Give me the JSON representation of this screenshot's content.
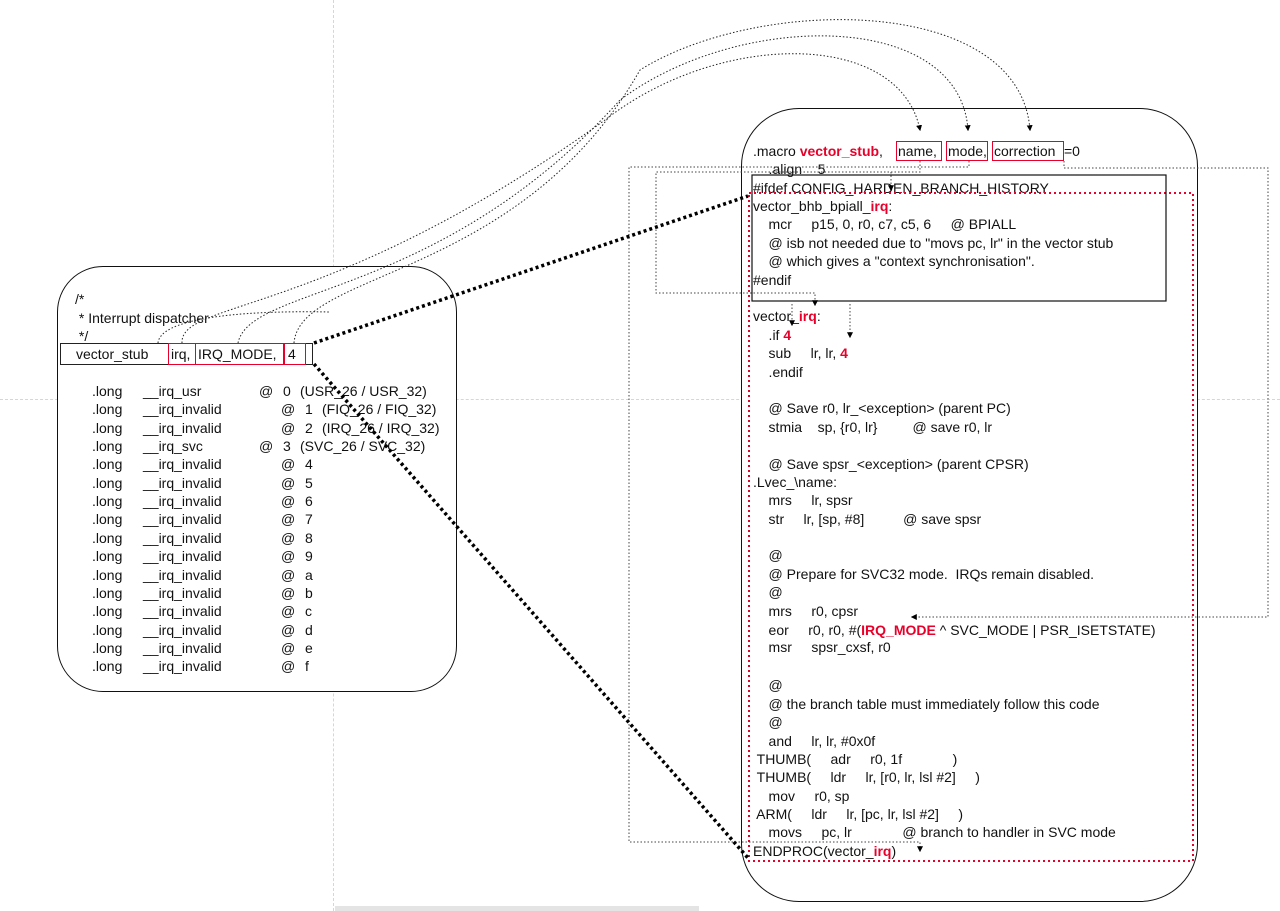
{
  "left_code": {
    "comment_open": "/*",
    "comment_text": " * Interrupt dispatcher",
    "comment_close": " */",
    "invocation": {
      "macro": "vector_stub",
      "arg_name": "irq,",
      "arg_mode": "IRQ_MODE,",
      "arg_correction": "4"
    },
    "table": [
      {
        "dir": ".long",
        "sym": "__irq_usr",
        "at": "@",
        "idx": "0",
        "comment": "(USR_26 / USR_32)"
      },
      {
        "dir": ".long",
        "sym": "__irq_invalid",
        "at": "@",
        "idx": "1",
        "comment": "(FIQ_26 / FIQ_32)"
      },
      {
        "dir": ".long",
        "sym": "__irq_invalid",
        "at": "@",
        "idx": "2",
        "comment": "(IRQ_26 / IRQ_32)"
      },
      {
        "dir": ".long",
        "sym": "__irq_svc",
        "at": "@",
        "idx": "3",
        "comment": "(SVC_26 / SVC_32)"
      },
      {
        "dir": ".long",
        "sym": "__irq_invalid",
        "at": "@",
        "idx": "4",
        "comment": ""
      },
      {
        "dir": ".long",
        "sym": "__irq_invalid",
        "at": "@",
        "idx": "5",
        "comment": ""
      },
      {
        "dir": ".long",
        "sym": "__irq_invalid",
        "at": "@",
        "idx": "6",
        "comment": ""
      },
      {
        "dir": ".long",
        "sym": "__irq_invalid",
        "at": "@",
        "idx": "7",
        "comment": ""
      },
      {
        "dir": ".long",
        "sym": "__irq_invalid",
        "at": "@",
        "idx": "8",
        "comment": ""
      },
      {
        "dir": ".long",
        "sym": "__irq_invalid",
        "at": "@",
        "idx": "9",
        "comment": ""
      },
      {
        "dir": ".long",
        "sym": "__irq_invalid",
        "at": "@",
        "idx": "a",
        "comment": ""
      },
      {
        "dir": ".long",
        "sym": "__irq_invalid",
        "at": "@",
        "idx": "b",
        "comment": ""
      },
      {
        "dir": ".long",
        "sym": "__irq_invalid",
        "at": "@",
        "idx": "c",
        "comment": ""
      },
      {
        "dir": ".long",
        "sym": "__irq_invalid",
        "at": "@",
        "idx": "d",
        "comment": ""
      },
      {
        "dir": ".long",
        "sym": "__irq_invalid",
        "at": "@",
        "idx": "e",
        "comment": ""
      },
      {
        "dir": ".long",
        "sym": "__irq_invalid",
        "at": "@",
        "idx": "f",
        "comment": ""
      }
    ]
  },
  "right_code": {
    "macro_kw": ".macro ",
    "macro_name": "vector_stub",
    "comma": ",",
    "param_name": "name,",
    "param_mode": "mode,",
    "param_correction": "correction",
    "param_default": "=0",
    "align": "    .align    5",
    "ifdef": "#ifdef CONFIG_HARDEN_BRANCH_HISTORY",
    "bhb_label_prefix": "vector_bhb_bpiall_",
    "bhb_label_irq": "irq",
    "bhb_label_suffix": ":",
    "mcr": "    mcr     p15, 0, r0, c7, c5, 6     @ BPIALL",
    "isb1": "    @ isb not needed due to \"movs pc, lr\" in the vector stub",
    "isb2": "    @ which gives a \"context synchronisation\".",
    "endif1": "#endif",
    "vec_prefix": "vector_",
    "vec_irq": "irq",
    "vec_suffix": ":",
    "if_kw": "    .if ",
    "if_val": "4",
    "sub_kw": "    sub     lr, lr, ",
    "sub_val": "4",
    "endif2": "    .endif",
    "save_r0": "    @ Save r0, lr_<exception> (parent PC)",
    "stmia": "    stmia    sp, {r0, lr}         @ save r0, lr",
    "save_spsr": "    @ Save spsr_<exception> (parent CPSR)",
    "lvec": ".Lvec_\\name:",
    "mrs1": "    mrs     lr, spsr",
    "str": "    str     lr, [sp, #8]          @ save spsr",
    "at1": "    @",
    "prepare": "    @ Prepare for SVC32 mode.  IRQs remain disabled.",
    "at2": "    @",
    "mrs2": "    mrs     r0, cpsr",
    "eor_prefix": "    eor     r0, r0, #(",
    "eor_mode": "IRQ_MODE",
    "eor_suffix": " ^ SVC_MODE | PSR_ISETSTATE)",
    "msr": "    msr     spsr_cxsf, r0",
    "at3": "    @",
    "branch_table": "    @ the branch table must immediately follow this code",
    "at4": "    @",
    "and": "    and     lr, lr, #0x0f",
    "thumb1": " THUMB(     adr     r0, 1f             )",
    "thumb2": " THUMB(     ldr     lr, [r0, lr, lsl #2]     )",
    "mov": "    mov     r0, sp",
    "arm": " ARM(     ldr     lr, [pc, lr, lsl #2]     )",
    "movs": "    movs     pc, lr             @ branch to handler in SVC mode",
    "endproc_prefix": "ENDPROC(vector_",
    "endproc_irq": "irq",
    "endproc_suffix": ")"
  },
  "colors": {
    "highlight": "#e8002a",
    "text": "#111111",
    "connector": "#000000"
  }
}
